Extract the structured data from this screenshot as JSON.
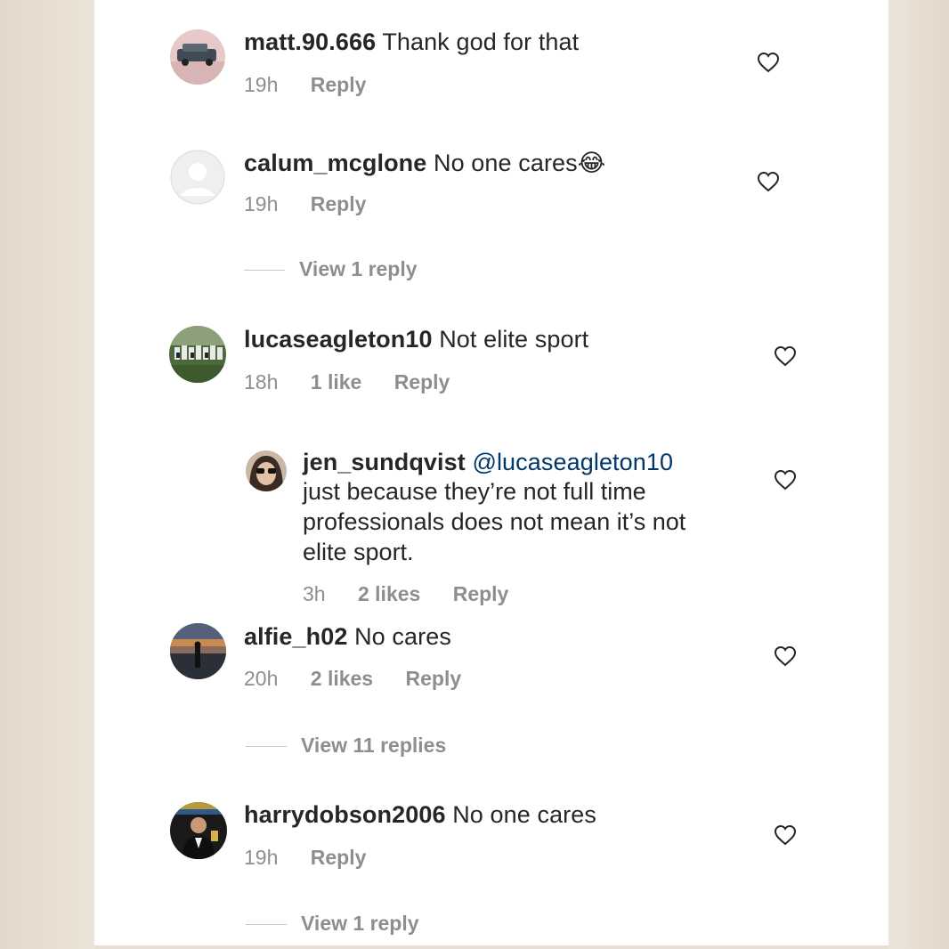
{
  "comments": [
    {
      "username": "matt.90.666",
      "text": "Thank god for that",
      "time": "19h",
      "likes": "",
      "reply": "Reply",
      "avatar": "car-avatar"
    },
    {
      "username": "calum_mcglone",
      "text": "No one cares",
      "emoji": "😂",
      "time": "19h",
      "likes": "",
      "reply": "Reply",
      "view_replies": "View 1 reply",
      "avatar": "default-avatar"
    },
    {
      "username": "lucaseagleton10",
      "text": "Not elite sport",
      "time": "18h",
      "likes": "1 like",
      "reply": "Reply",
      "avatar": "team-avatar"
    },
    {
      "username": "jen_sundqvist",
      "mention": "@lucaseagleton10",
      "text_lines": [
        "just because they’re not full time",
        "professionals does not mean it’s not",
        "elite sport."
      ],
      "time": "3h",
      "likes": "2 likes",
      "reply": "Reply",
      "avatar": "person-sunglasses-avatar"
    },
    {
      "username": "alfie_h02",
      "text": "No cares",
      "time": "20h",
      "likes": "2 likes",
      "reply": "Reply",
      "view_replies": "View 11 replies",
      "avatar": "sunset-avatar"
    },
    {
      "username": "harrydobson2006",
      "text": "No one cares",
      "time": "19h",
      "likes": "",
      "reply": "Reply",
      "view_replies": "View 1 reply",
      "avatar": "suit-avatar"
    }
  ],
  "colors": {
    "text": "#262626",
    "secondary": "#8e8e8e",
    "mention": "#00376b",
    "background": "#ffffff"
  }
}
